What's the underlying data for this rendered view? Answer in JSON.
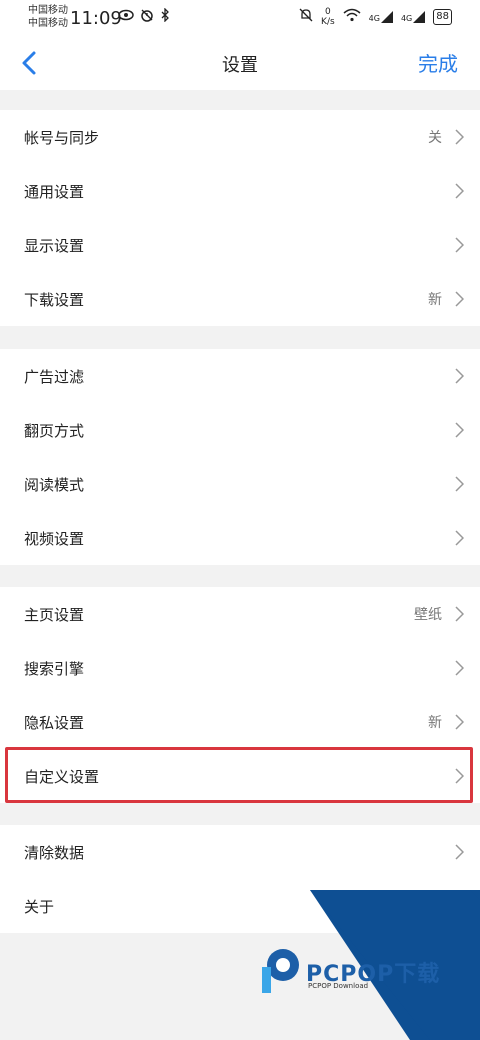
{
  "status_bar": {
    "carrier1": "中国移动",
    "carrier2": "中国移动",
    "time": "11:09",
    "net_speed_value": "0",
    "net_speed_unit": "K/s",
    "signal1": "4G",
    "signal2": "4G",
    "battery": "88"
  },
  "nav": {
    "title": "设置",
    "done_label": "完成"
  },
  "groups": [
    {
      "items": [
        {
          "label": "帐号与同步",
          "value": "关"
        },
        {
          "label": "通用设置",
          "value": ""
        },
        {
          "label": "显示设置",
          "value": ""
        },
        {
          "label": "下载设置",
          "value": "新"
        }
      ]
    },
    {
      "items": [
        {
          "label": "广告过滤",
          "value": ""
        },
        {
          "label": "翻页方式",
          "value": ""
        },
        {
          "label": "阅读模式",
          "value": ""
        },
        {
          "label": "视频设置",
          "value": ""
        }
      ]
    },
    {
      "items": [
        {
          "label": "主页设置",
          "value": "壁纸"
        },
        {
          "label": "搜索引擎",
          "value": ""
        },
        {
          "label": "隐私设置",
          "value": "新"
        },
        {
          "label": "自定义设置",
          "value": ""
        }
      ]
    },
    {
      "items": [
        {
          "label": "清除数据",
          "value": ""
        },
        {
          "label": "关于",
          "value": ""
        }
      ]
    }
  ],
  "watermark": {
    "brand": "PCPOP下载",
    "sub": "PCPOP Download"
  },
  "colors": {
    "accent": "#2a7ee8",
    "highlight": "#d9363e",
    "watermark_blue": "#0e4f93"
  }
}
